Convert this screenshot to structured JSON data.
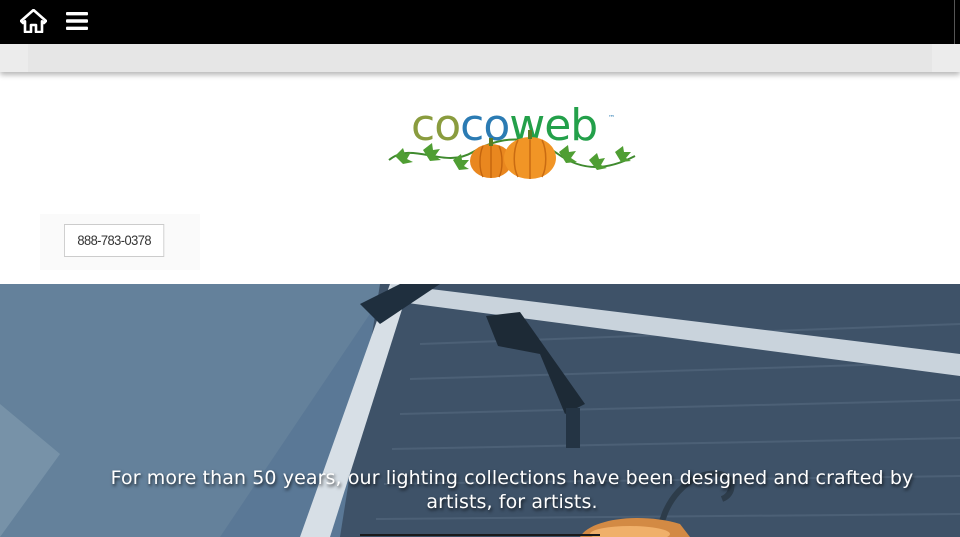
{
  "nav": {
    "home_icon": "home-icon",
    "menu_icon": "hamburger-menu-icon",
    "background": "#000000"
  },
  "logo": {
    "part1": "co",
    "part2": "co",
    "part3": "web",
    "trademark": "™",
    "colors": {
      "co1": "#8a9c3e",
      "co2": "#2b7bb3",
      "web": "#23a04a"
    }
  },
  "contact": {
    "phone": "888-783-0378"
  },
  "hero": {
    "caption": "For more than 50 years, our lighting collections have been designed and crafted by artists, for artists."
  }
}
